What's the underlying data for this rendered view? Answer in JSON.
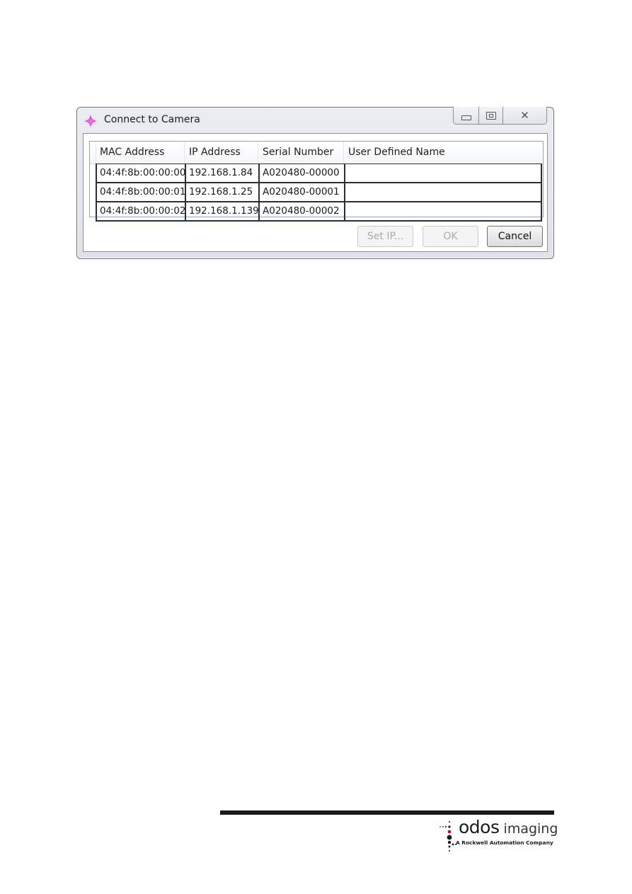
{
  "window": {
    "title": "Connect to Camera",
    "icon": "magenta-star-icon",
    "controls": {
      "minimize": "minimize-icon",
      "maximize": "maximize-icon",
      "close": "close-icon"
    }
  },
  "grid": {
    "columns": [
      "MAC Address",
      "IP Address",
      "Serial Number",
      "User Defined Name"
    ],
    "rows": [
      {
        "mac": "04:4f:8b:00:00:00",
        "ip": "192.168.1.84",
        "serial": "A020480-00000",
        "name": ""
      },
      {
        "mac": "04:4f:8b:00:00:01",
        "ip": "192.168.1.25",
        "serial": "A020480-00001",
        "name": ""
      },
      {
        "mac": "04:4f:8b:00:00:02",
        "ip": "192.168.1.139",
        "serial": "A020480-00002",
        "name": ""
      }
    ]
  },
  "buttons": {
    "set_ip": {
      "label": "Set IP...",
      "enabled": false
    },
    "ok": {
      "label": "OK",
      "enabled": false
    },
    "cancel": {
      "label": "Cancel",
      "enabled": true
    }
  },
  "footer": {
    "logo_name_bold": "odos",
    "logo_name_light": " imaging",
    "logo_tagline": "A Rockwell Automation Company",
    "accent_color": "#c8102e"
  }
}
